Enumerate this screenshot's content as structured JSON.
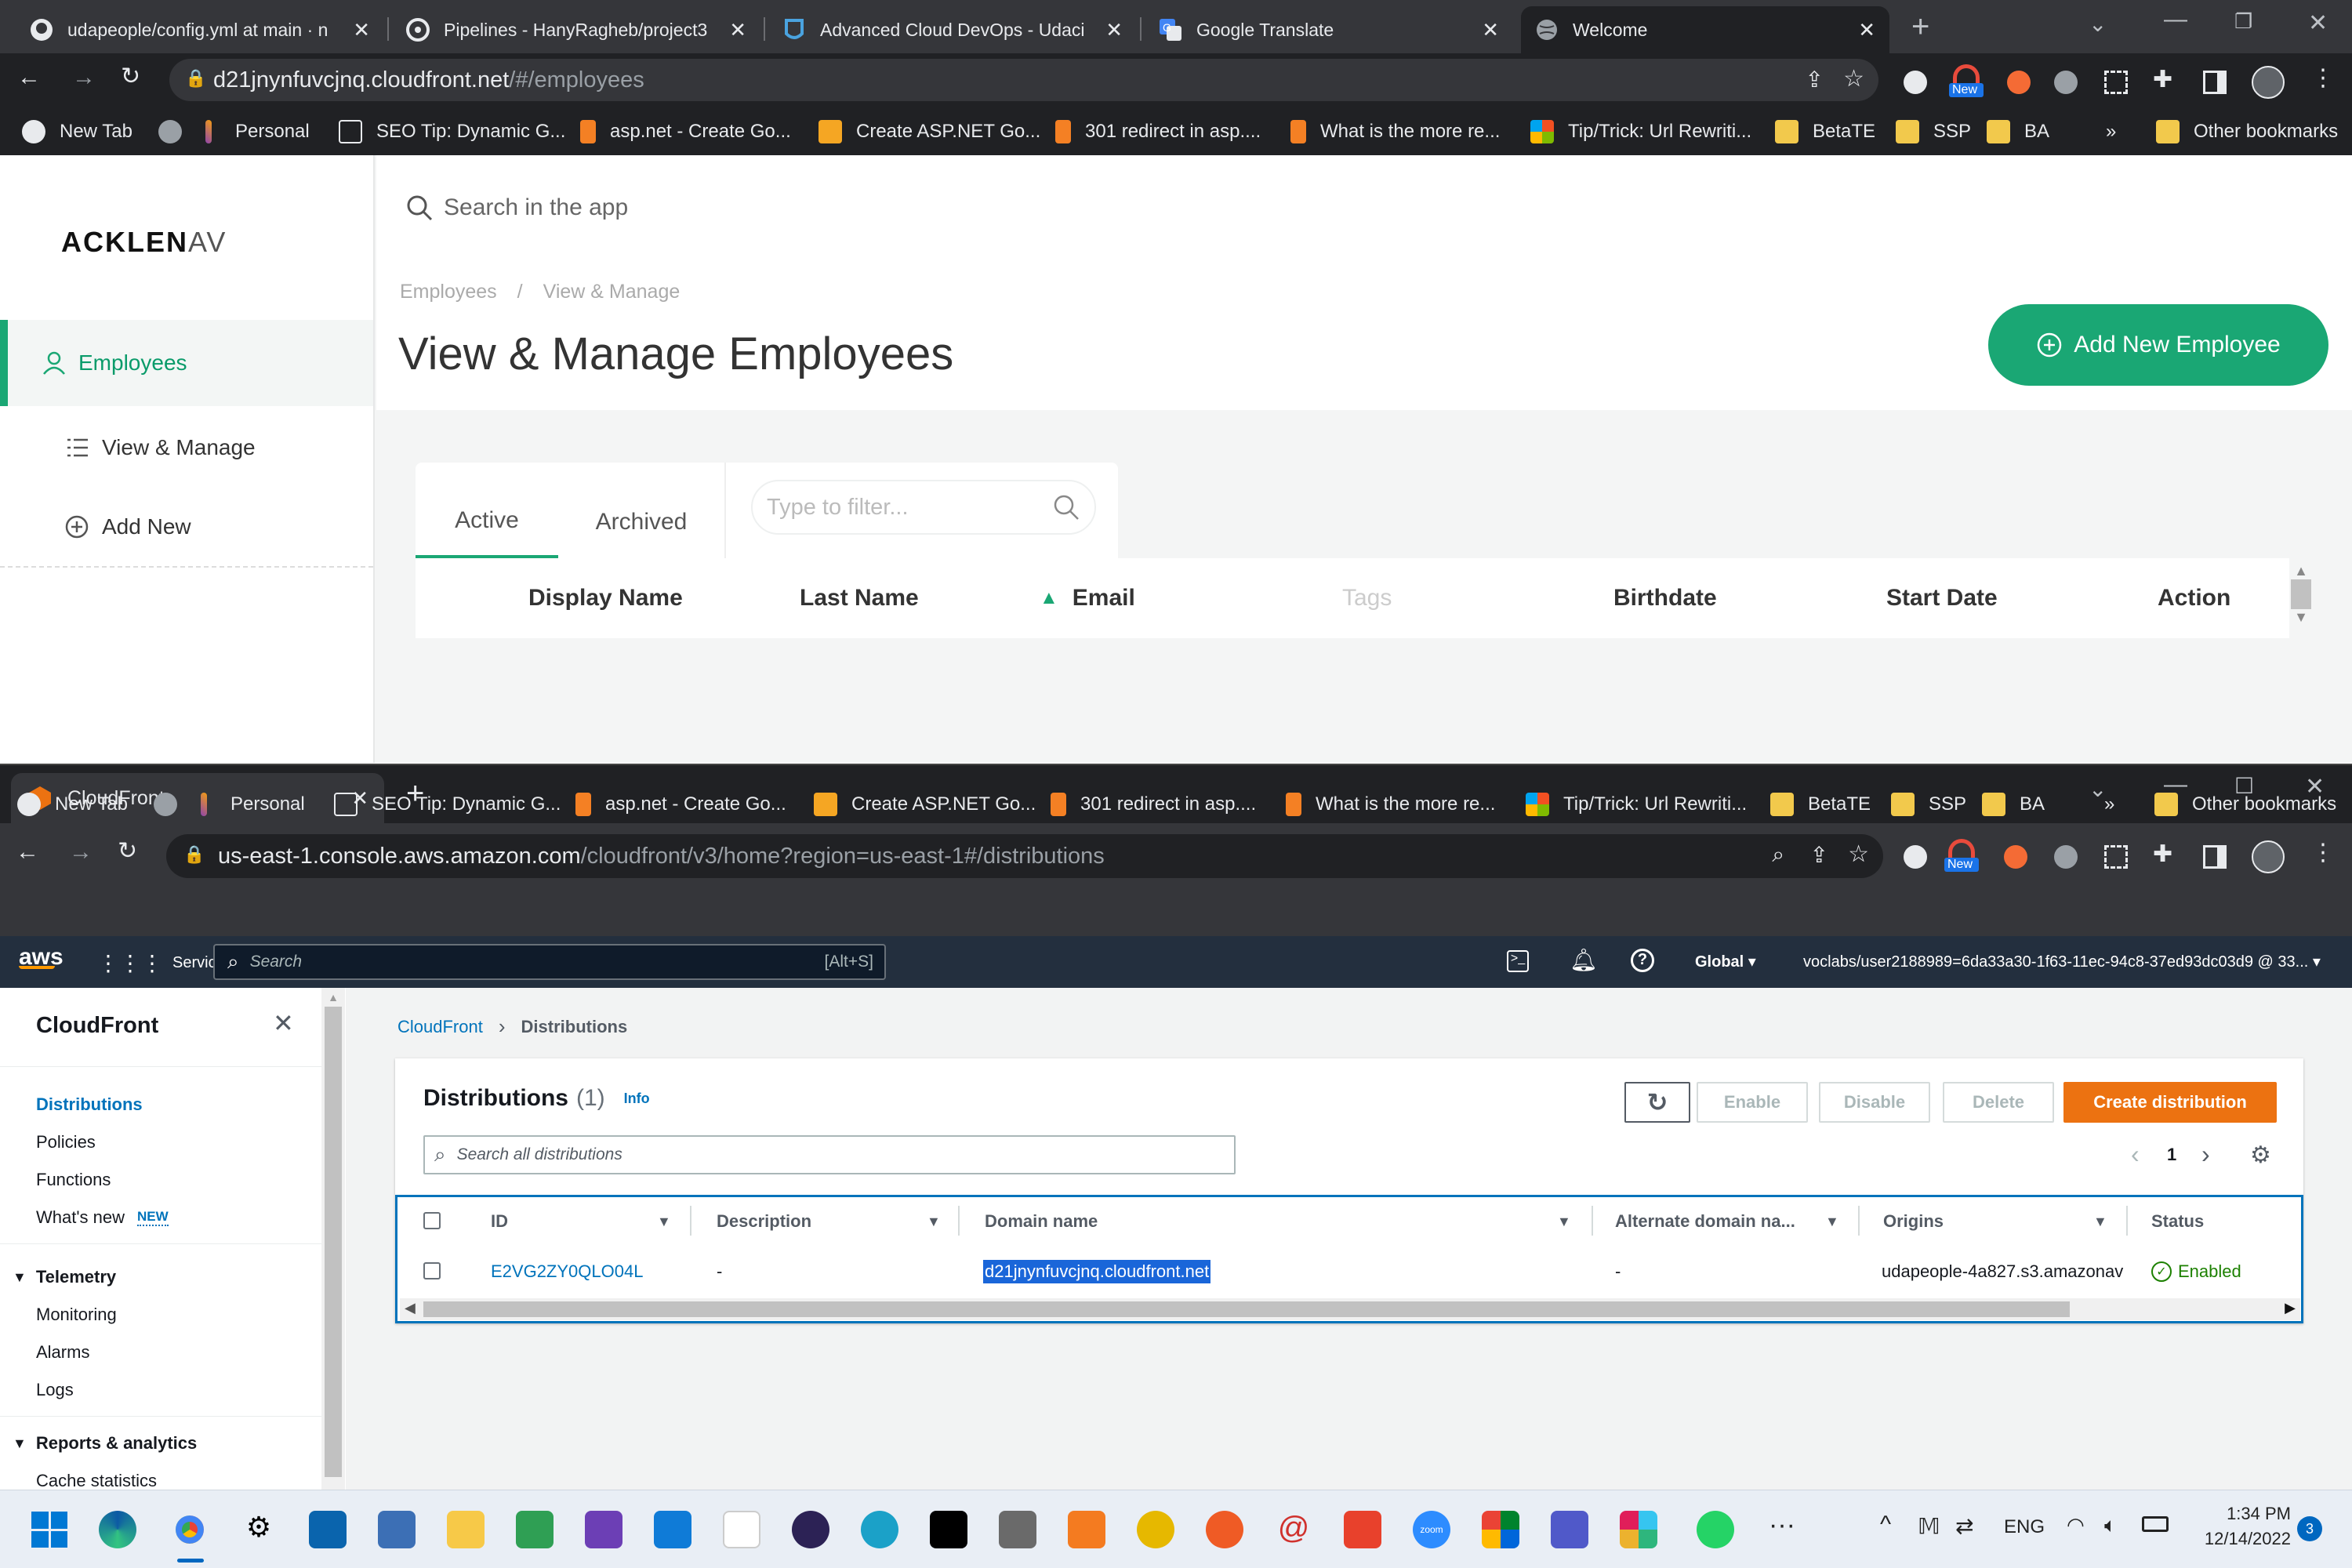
{
  "window1": {
    "tabs": [
      {
        "title": "udapeople/config.yml at main · n",
        "icon": "github-icon"
      },
      {
        "title": "Pipelines - HanyRagheb/project3",
        "icon": "circleci-icon"
      },
      {
        "title": "Advanced Cloud DevOps - Udaci",
        "icon": "udacity-icon"
      },
      {
        "title": "Google Translate",
        "icon": "google-translate-icon"
      },
      {
        "title": "Welcome",
        "icon": "globe-icon"
      }
    ],
    "url_host": "d21jnynfuvcjnq.cloudfront.net",
    "url_path": "/#/employees",
    "extension_badge": "New"
  },
  "bookmarks": [
    {
      "label": "New Tab"
    },
    {
      "label": "Personal"
    },
    {
      "label": "SEO Tip: Dynamic G..."
    },
    {
      "label": "asp.net - Create Go..."
    },
    {
      "label": "Create ASP.NET Go..."
    },
    {
      "label": "301 redirect in asp...."
    },
    {
      "label": "What is the more re..."
    },
    {
      "label": "Tip/Trick: Url Rewriti..."
    },
    {
      "label": "BetaTE"
    },
    {
      "label": "SSP"
    },
    {
      "label": "BA"
    }
  ],
  "bookmarks_more": "»",
  "bookmarks_other": "Other bookmarks",
  "app": {
    "logo_bold": "ACKLEN",
    "logo_light": "AV",
    "nav": {
      "employees": "Employees",
      "view_manage": "View & Manage",
      "add_new": "Add New"
    },
    "search_placeholder": "Search in the app",
    "breadcrumb": {
      "first": "Employees",
      "sep": "/",
      "second": "View & Manage"
    },
    "page_title": "View & Manage Employees",
    "add_button": "Add New Employee",
    "tabs": {
      "active": "Active",
      "archived": "Archived"
    },
    "filter_placeholder": "Type to filter...",
    "columns": {
      "display_name": "Display Name",
      "last_name": "Last Name",
      "email": "Email",
      "tags": "Tags",
      "birthdate": "Birthdate",
      "start_date": "Start Date",
      "action": "Action"
    },
    "sort_indicator": "▲"
  },
  "window2": {
    "tab_title": "CloudFront",
    "url_host": "us-east-1.console.aws.amazon.com",
    "url_path": "/cloudfront/v3/home?region=us-east-1#/distributions",
    "extension_badge": "New"
  },
  "aws": {
    "logo": "aws",
    "services": "Services",
    "search_placeholder": "Search",
    "search_shortcut": "[Alt+S]",
    "region": "Global ▾",
    "account": "voclabs/user2188989=6da33a30-1f63-11ec-94c8-37ed93dc03d9 @ 33... ▾",
    "sidebar": {
      "title": "CloudFront",
      "links": [
        "Distributions",
        "Policies",
        "Functions",
        "What's new"
      ],
      "new_badge": "NEW",
      "telemetry": "Telemetry",
      "telemetry_links": [
        "Monitoring",
        "Alarms",
        "Logs"
      ],
      "reports": "Reports & analytics",
      "reports_links": [
        "Cache statistics"
      ]
    },
    "breadcrumb": {
      "root": "CloudFront",
      "current": "Distributions"
    },
    "panel_title": "Distributions",
    "panel_count": "(1)",
    "info": "Info",
    "buttons": {
      "enable": "Enable",
      "disable": "Disable",
      "delete": "Delete",
      "create": "Create distribution"
    },
    "search_placeholder_table": "Search all distributions",
    "page_number": "1",
    "columns": [
      "ID",
      "Description",
      "Domain name",
      "Alternate domain na...",
      "Origins",
      "Status"
    ],
    "row": {
      "id": "E2VG2ZY0QLO04L",
      "description": "-",
      "domain": "d21jnynfuvcjnq.cloudfront.net",
      "alternate": "-",
      "origins": "udapeople-4a827.s3.amazonav",
      "status": "Enabled"
    }
  },
  "taskbar": {
    "lang": "ENG",
    "time": "1:34 PM",
    "date": "12/14/2022",
    "notifications": "3"
  },
  "colors": {
    "app_green": "#1aa774",
    "aws_orange": "#ec7211",
    "aws_blue": "#0073bb",
    "aws_nav": "#232f3e",
    "chrome_dark": "#202124"
  }
}
